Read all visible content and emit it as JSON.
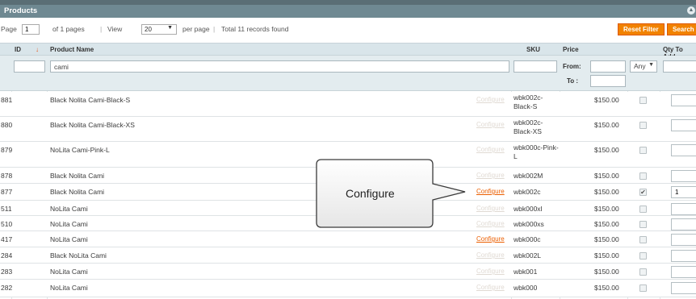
{
  "panel": {
    "title": "Products",
    "collapse_icon": "chevron-up-icon"
  },
  "pager": {
    "page_label": "Page",
    "page_value": "1",
    "of_pages": "of 1 pages",
    "sep1": "|",
    "view_label": "View",
    "view_value": "20",
    "per_page": "per page",
    "sep2": "|",
    "total": "Total 11 records found"
  },
  "buttons": {
    "reset_filter": "Reset Filter",
    "search": "Search"
  },
  "columns": {
    "id": "ID",
    "sort_icon": "arrow-down-icon",
    "name": "Product Name",
    "sku": "SKU",
    "price": "Price",
    "qty": "Qty To Add"
  },
  "filters": {
    "name_value": "cami",
    "from_label": "From:",
    "to_label": "To :",
    "any_value": "Any"
  },
  "rows": [
    {
      "id": "881",
      "name": "Black Nolita Cami-Black-S",
      "configure": "Configure",
      "sku": "wbk002c-Black-S",
      "price": "$150.00",
      "checked": "",
      "qty": ""
    },
    {
      "id": "880",
      "name": "Black Nolita Cami-Black-XS",
      "configure": "Configure",
      "sku": "wbk002c-Black-XS",
      "price": "$150.00",
      "checked": "",
      "qty": ""
    },
    {
      "id": "879",
      "name": "NoLita Cami-Pink-L",
      "configure": "Configure",
      "sku": "wbk000c-Pink-L",
      "price": "$150.00",
      "checked": "",
      "qty": ""
    },
    {
      "id": "878",
      "name": "Black Nolita Cami",
      "configure": "Configure",
      "sku": "wbk002M",
      "price": "$150.00",
      "checked": "",
      "qty": ""
    },
    {
      "id": "877",
      "name": "Black Nolita Cami",
      "configure": "Configure",
      "sku": "wbk002c",
      "price": "$150.00",
      "checked": "✔",
      "qty": "1"
    },
    {
      "id": "511",
      "name": "NoLita Cami",
      "configure": "Configure",
      "sku": "wbk000xl",
      "price": "$150.00",
      "checked": "",
      "qty": ""
    },
    {
      "id": "510",
      "name": "NoLita Cami",
      "configure": "Configure",
      "sku": "wbk000xs",
      "price": "$150.00",
      "checked": "",
      "qty": ""
    },
    {
      "id": "417",
      "name": "NoLita Cami",
      "configure": "Configure",
      "sku": "wbk000c",
      "price": "$150.00",
      "checked": "",
      "qty": ""
    },
    {
      "id": "284",
      "name": "Black NoLita Cami",
      "configure": "Configure",
      "sku": "wbk002L",
      "price": "$150.00",
      "checked": "",
      "qty": ""
    },
    {
      "id": "283",
      "name": "NoLita Cami",
      "configure": "Configure",
      "sku": "wbk001",
      "price": "$150.00",
      "checked": "",
      "qty": ""
    },
    {
      "id": "282",
      "name": "NoLita Cami",
      "configure": "Configure",
      "sku": "wbk000",
      "price": "$150.00",
      "checked": "",
      "qty": ""
    }
  ],
  "callout": {
    "text": "Configure"
  },
  "colors": {
    "accent": "#f18200",
    "link_active": "#eb5e00",
    "header_bar": "#6f8992"
  }
}
